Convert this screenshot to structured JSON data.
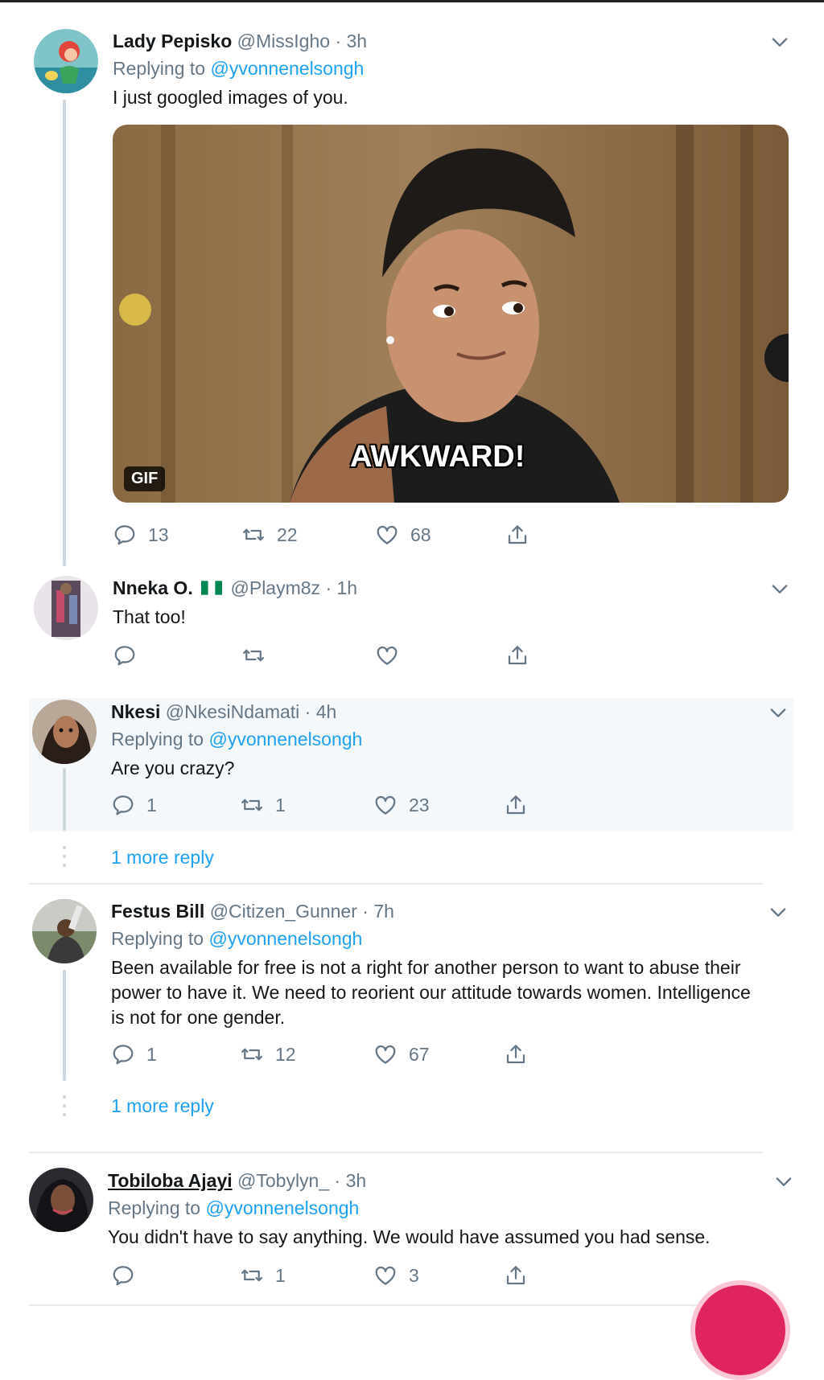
{
  "tweets": [
    {
      "name": "Lady Pepisko",
      "handle": "@MissIgho",
      "time": "· 3h",
      "replying_label": "Replying to",
      "replying_to": "@yvonnenelsongh",
      "text": "I just googled images of you.",
      "gif": {
        "badge": "GIF",
        "caption": "AWKWARD!"
      },
      "counts": {
        "replies": "13",
        "retweets": "22",
        "likes": "68"
      }
    },
    {
      "name": "Nneka O.",
      "handle": "@Playm8z",
      "time": "· 1h",
      "text": "That too!",
      "counts": {
        "replies": "",
        "retweets": "",
        "likes": ""
      }
    },
    {
      "name": "Nkesi",
      "handle": "@NkesiNdamati",
      "time": "· 4h",
      "replying_label": "Replying to",
      "replying_to": "@yvonnenelsongh",
      "text": "Are you crazy?",
      "counts": {
        "replies": "1",
        "retweets": "1",
        "likes": "23"
      },
      "more_reply": "1 more reply"
    },
    {
      "name": "Festus Bill",
      "handle": "@Citizen_Gunner",
      "time": "· 7h",
      "replying_label": "Replying to",
      "replying_to": "@yvonnenelsongh",
      "text": "Been available for free is not a right for another person to want to abuse their power to have it. We need to reorient our attitude towards women. Intelligence is not for one gender.",
      "counts": {
        "replies": "1",
        "retweets": "12",
        "likes": "67"
      },
      "more_reply": "1 more reply"
    },
    {
      "name": "Tobiloba Ajayi",
      "handle": "@Tobylyn_",
      "time": "· 3h",
      "replying_label": "Replying to",
      "replying_to": "@yvonnenelsongh",
      "text": "You didn't have to say anything. We would have assumed you had sense.",
      "counts": {
        "replies": "",
        "retweets": "1",
        "likes": "3"
      }
    }
  ],
  "colors": {
    "link": "#1da1f2",
    "muted": "#657786",
    "shaded_bg": "#f5f8fa"
  }
}
